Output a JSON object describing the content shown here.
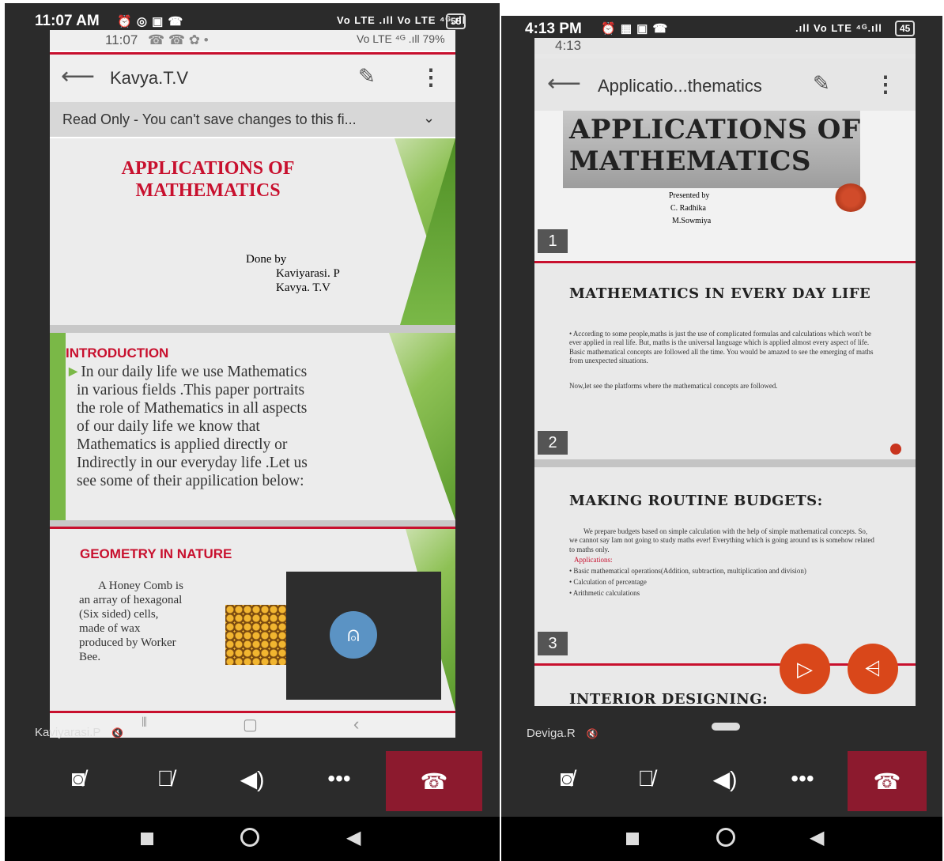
{
  "left": {
    "status_time": "11:07 AM",
    "status_icons": "⏰ ◎ ▣ ☎",
    "status_signal": "Vo LTE .ıll Vo LTE ⁴ᴳ.ıll",
    "battery": "55",
    "inner_time": "11:07",
    "inner_icons": "☎ ☎ ✿ •",
    "inner_right": "Vo LTE ⁴ᴳ .ıll 79%",
    "appbar_title": "Kavya.T.V",
    "readonly_text": "Read Only - You can't save changes to this fi...",
    "slide1": {
      "title_line1": "APPLICATIONS OF",
      "title_line2": "MATHEMATICS",
      "done_by": "Done by",
      "author1": "Kaviyarasi. P",
      "author2": "Kavya. T.V"
    },
    "slide2": {
      "heading": "INTRODUCTION",
      "bullet": "►",
      "line1": "In our daily life we use Mathematics",
      "line2": "in  various fields .This paper portraits",
      "line3": "the role of  Mathematics in all aspects",
      "line4": "of our daily life we know that",
      "line5": "Mathematics is applied directly or",
      "line6": "Indirectly in our everyday life .Let us",
      "line7": "see some of their appilication  below:"
    },
    "slide3": {
      "heading": "GEOMETRY IN NATURE",
      "line1": "A Honey Comb is",
      "line2": "an array of hexagonal",
      "line3": "(Six sided) cells,",
      "line4": "made of wax",
      "line5": "produced by Worker",
      "line6": "Bee."
    },
    "participant_name": "Kaviyarasi.P",
    "participant_mic": "🔇"
  },
  "right": {
    "status_time": "4:13 PM",
    "status_icons": "⏰ ▦ ▣ ☎",
    "status_signal": ".ıll Vo LTE ⁴ᴳ.ıll",
    "battery": "45",
    "inner_time": "4:13",
    "appbar_title": "Applicatio...thematics",
    "slide1": {
      "title_line1": "APPLICATIONS OF",
      "title_line2": "MATHEMATICS",
      "presented_by": "Presented by",
      "author1": "C. Radhika",
      "author2": "M.Sowmiya",
      "page": "1"
    },
    "slide2": {
      "heading": "MATHEMATICS IN EVERY DAY LIFE",
      "para1": "• According to some people,maths is just the use of complicated formulas and calculations  which won't be ever applied in real life. But, maths is the universal language which is applied almost every aspect of life. Basic mathematical concepts are followed all the time. You would be amazed to see the emerging of maths from unexpected situations.",
      "para2": "Now,let see the platforms where the mathematical concepts are followed.",
      "page": "2"
    },
    "slide3": {
      "heading": "MAKING ROUTINE BUDGETS:",
      "para": "We prepare budgets based on simple calculation with the help of simple mathematical concepts. So, we cannot say Iam not going to study maths ever! Everything which is going around us is somehow related to maths only.",
      "apps_label": "Applications:",
      "item1": "• Basic mathematical operations(Addition, subtraction, multiplication and division)",
      "item2": "• Calculation of percentage",
      "item3": "• Arithmetic calculations",
      "page": "3"
    },
    "slide4": {
      "heading": "INTERIOR DESIGNING:"
    },
    "participant_name": "Deviga.R",
    "participant_mic": "🔇"
  },
  "colors": {
    "hangup": "#8c1a2e",
    "accent_red": "#c8102e",
    "fab": "#d9471a",
    "avatar": "#5b93c4"
  }
}
